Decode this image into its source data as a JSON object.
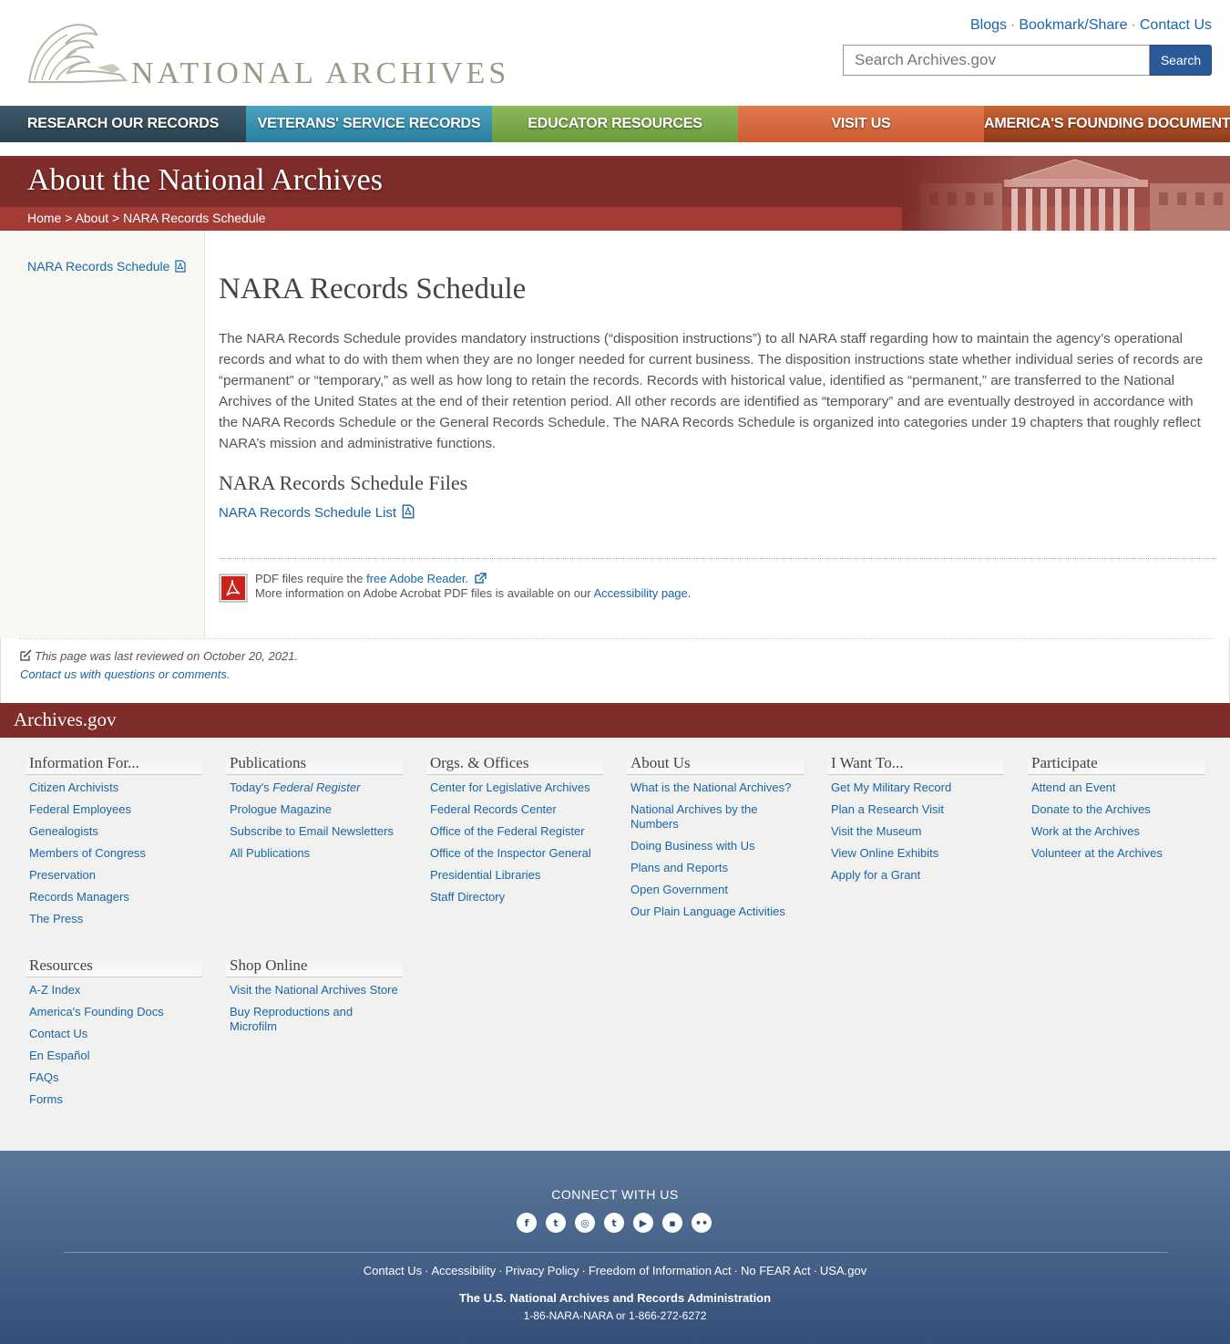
{
  "header": {
    "logo_text": "NATIONAL ARCHIVES",
    "util_links": [
      "Blogs",
      "Bookmark/Share",
      "Contact Us"
    ],
    "search_placeholder": "Search Archives.gov",
    "search_button": "Search"
  },
  "nav": {
    "items": [
      {
        "label": "Research Our Records",
        "color": "#34505e"
      },
      {
        "label": "Veterans' Service Records",
        "color": "#3a93b2"
      },
      {
        "label": "Educator Resources",
        "color": "#7caa4c"
      },
      {
        "label": "Visit Us",
        "color": "#d66a40"
      },
      {
        "label": "America's Founding Documents",
        "color": "#ab4c26"
      }
    ]
  },
  "banner": {
    "title": "About the National Archives",
    "breadcrumb": {
      "home": "Home",
      "sep1": ">",
      "about": "About",
      "sep2": ">",
      "current": "NARA Records Schedule"
    }
  },
  "sidebar": {
    "link": "NARA Records Schedule"
  },
  "main": {
    "title": "NARA Records Schedule",
    "intro": "The NARA Records Schedule provides mandatory instructions (“disposition instructions”) to all NARA staff regarding how to maintain the agency’s operational records and what to do with them when they are no longer needed for current business. The disposition instructions state whether individual series of records are “permanent” or “temporary,” as well as how long to retain the records. Records with historical value, identified as “permanent,” are transferred to the National Archives of the United States at the end of their retention period. All other records are identified as “temporary” and are eventually destroyed in accordance with the NARA Records Schedule or the General Records Schedule. The NARA Records Schedule is organized into categories under 19 chapters that roughly reflect NARA’s mission and administrative functions.",
    "files_heading": "NARA Records Schedule Files",
    "files_link": "NARA Records Schedule List",
    "pdf_note": {
      "line1_prefix": "PDF files require the ",
      "line1_link": "free Adobe Reader.",
      "line2_prefix": "More information on Adobe Acrobat PDF files is available on our ",
      "line2_link": "Accessibility page",
      "line2_suffix": "."
    }
  },
  "review": {
    "last_reviewed": "This page was last reviewed on October 20, 2021.",
    "contact": "Contact us with questions or comments."
  },
  "footer": {
    "bar_title": "Archives.gov",
    "columns": [
      {
        "title": "Information For...",
        "items": [
          "Citizen Archivists",
          "Federal Employees",
          "Genealogists",
          "Members of Congress",
          "Preservation",
          "Records Managers",
          "The Press"
        ]
      },
      {
        "title": "Publications",
        "items": [
          "Today's Federal Register",
          "Prologue Magazine",
          "Subscribe to Email Newsletters",
          "All Publications"
        ]
      },
      {
        "title": "Orgs. & Offices",
        "items": [
          "Center for Legislative Archives",
          "Federal Records Center",
          "Office of the Federal Register",
          "Office of the Inspector General",
          "Presidential Libraries",
          "Staff Directory"
        ]
      },
      {
        "title": "About Us",
        "items": [
          "What is the National Archives?",
          "National Archives by the Numbers",
          "Doing Business with Us",
          "Plans and Reports",
          "Open Government",
          "Our Plain Language Activities"
        ]
      },
      {
        "title": "I Want To...",
        "items": [
          "Get My Military Record",
          "Plan a Research Visit",
          "Visit the Museum",
          "View Online Exhibits",
          "Apply for a Grant"
        ]
      },
      {
        "title": "Participate",
        "items": [
          "Attend an Event",
          "Donate to the Archives",
          "Work at the Archives",
          "Volunteer at the Archives"
        ]
      },
      {
        "title": "Resources",
        "items": [
          "A-Z Index",
          "America's Founding Docs",
          "Contact Us",
          "En Español",
          "FAQs",
          "Forms"
        ]
      },
      {
        "title": "Shop Online",
        "items": [
          "Visit the National Archives Store",
          "Buy Reproductions and Microfilm"
        ]
      }
    ],
    "connect_title": "CONNECT WITH US",
    "social": [
      {
        "name": "facebook-icon",
        "glyph": "f"
      },
      {
        "name": "twitter-icon",
        "glyph": "t"
      },
      {
        "name": "instagram-icon",
        "glyph": "◎"
      },
      {
        "name": "tumblr-icon",
        "glyph": "t"
      },
      {
        "name": "youtube-icon",
        "glyph": "▶"
      },
      {
        "name": "blog-icon",
        "glyph": "▪"
      },
      {
        "name": "flickr-icon",
        "glyph": "••"
      }
    ],
    "legal_links": [
      "Contact Us",
      "Accessibility",
      "Privacy Policy",
      "Freedom of Information Act",
      "No FEAR Act",
      "USA.gov"
    ],
    "agency": "The U.S. National Archives and Records Administration",
    "phone": "1-86-NARA-NARA or 1-866-272-6272"
  }
}
